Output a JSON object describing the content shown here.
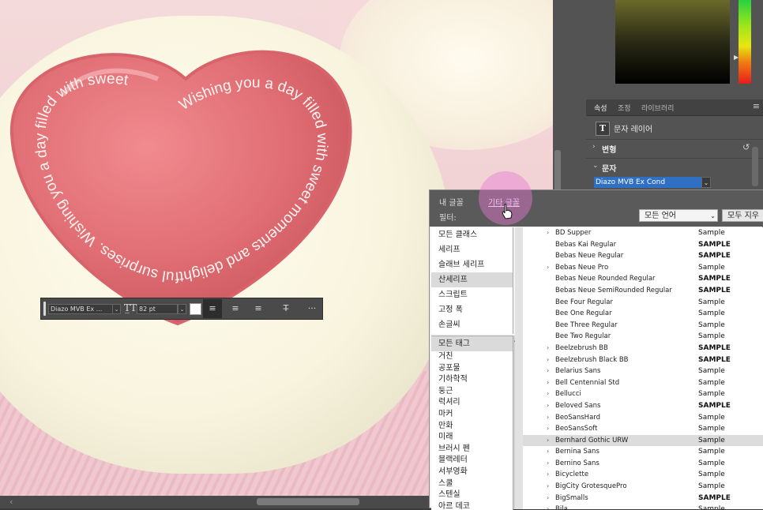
{
  "canvas": {
    "curved_text": "Wishing you a day filled with sweet moments and delightful surprises. Wishing you a day filled with sweet"
  },
  "properties_panel": {
    "tabs": [
      "속성",
      "조정",
      "라이브러리"
    ],
    "layer_type": "문자 레이어",
    "sections": {
      "transform": "변형",
      "character": "문자"
    },
    "font_value": "Diazo MVB Ex Cond"
  },
  "options_bar": {
    "font_family": "Diazo MVB Ex ...",
    "font_size": "82 pt",
    "text_color": "#ffffff",
    "more": "···"
  },
  "font_menu": {
    "tab_my_fonts": "내 글꼴",
    "tab_other_fonts": "기타 글꼴",
    "filter_label": "필터:",
    "language_select": "모든 언어",
    "clear_all": "모두 지우",
    "classes": [
      "모든 클래스",
      "세리프",
      "슬래브 세리프",
      "산세리프",
      "스크립트",
      "고정 폭",
      "손글씨"
    ],
    "selected_class": "산세리프",
    "tags": [
      "모든 태그",
      "거친",
      "공포물",
      "기하학적",
      "둥근",
      "럭셔리",
      "마커",
      "만화",
      "미래",
      "브러시 펜",
      "블랙레터",
      "서부영화",
      "스쿨",
      "스텐실",
      "아르 데코"
    ],
    "fonts": [
      {
        "name": "BD Supper",
        "expand": true,
        "sample": "Sample"
      },
      {
        "name": "Bebas Kai Regular",
        "expand": false,
        "sample": "SAMPLE"
      },
      {
        "name": "Bebas Neue Regular",
        "expand": false,
        "sample": "SAMPLE"
      },
      {
        "name": "Bebas Neue Pro",
        "expand": true,
        "sample": "Sample"
      },
      {
        "name": "Bebas Neue Rounded Regular",
        "expand": false,
        "sample": "SAMPLE"
      },
      {
        "name": "Bebas Neue SemiRounded Regular",
        "expand": false,
        "sample": "SAMPLE"
      },
      {
        "name": "Bee Four Regular",
        "expand": false,
        "sample": "Sample"
      },
      {
        "name": "Bee One Regular",
        "expand": false,
        "sample": "Sample"
      },
      {
        "name": "Bee Three Regular",
        "expand": false,
        "sample": "Sample"
      },
      {
        "name": "Bee Two Regular",
        "expand": false,
        "sample": "Sample"
      },
      {
        "name": "Beelzebrush BB",
        "expand": true,
        "sample": "SAMPLE"
      },
      {
        "name": "Beelzebrush Black BB",
        "expand": true,
        "sample": "SAMPLE"
      },
      {
        "name": "Belarius Sans",
        "expand": true,
        "sample": "Sample"
      },
      {
        "name": "Bell Centennial Std",
        "expand": true,
        "sample": "Sample"
      },
      {
        "name": "Bellucci",
        "expand": true,
        "sample": "Sample"
      },
      {
        "name": "Beloved Sans",
        "expand": true,
        "sample": "SAMPLE"
      },
      {
        "name": "BeoSansHard",
        "expand": true,
        "sample": "Sample"
      },
      {
        "name": "BeoSansSoft",
        "expand": true,
        "sample": "Sample"
      },
      {
        "name": "Bernhard Gothic URW",
        "expand": true,
        "sample": "Sample"
      },
      {
        "name": "Bernina Sans",
        "expand": true,
        "sample": "Sample"
      },
      {
        "name": "Bernino Sans",
        "expand": true,
        "sample": "Sample"
      },
      {
        "name": "Bicyclette",
        "expand": true,
        "sample": "Sample"
      },
      {
        "name": "BigCity GrotesquePro",
        "expand": true,
        "sample": "Sample"
      },
      {
        "name": "BigSmalls",
        "expand": true,
        "sample": "SAMPLE"
      },
      {
        "name": "Bila",
        "expand": true,
        "sample": "Sample"
      }
    ],
    "selected_font": "Bernhard Gothic URW"
  }
}
